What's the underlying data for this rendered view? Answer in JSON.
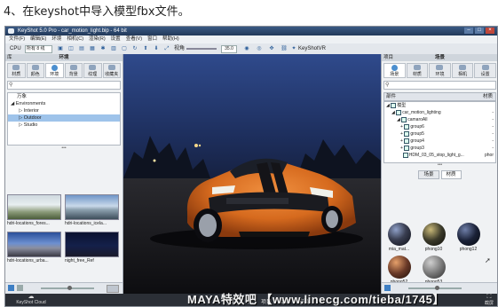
{
  "caption": "4、在keyshot中导入模型fbx文件。",
  "window": {
    "title": "KeyShot 5.0 Pro - car_motion_light.bip - 64 bit"
  },
  "menu": [
    "文件(F)",
    "编辑(E)",
    "环境",
    "相机(C)",
    "渲染(R)",
    "设置",
    "查看(V)",
    "窗口",
    "帮助(H)"
  ],
  "toolbar": {
    "cpu_label": "CPU",
    "cpu_value": "所有 8 线",
    "sight_label": "视角",
    "sight_value": "35.0",
    "vr_label": "KeyShotVR"
  },
  "library": {
    "header_left": "库",
    "title": "环境",
    "tabs": [
      "材质",
      "颜色",
      "环境",
      "背景",
      "纹理",
      "收藏夹"
    ],
    "tree": [
      "万象",
      "Environments",
      "Interior",
      "Outdoor",
      "Studio"
    ],
    "thumbs": [
      "hdri-locations_fores...",
      "hdri-locations_icela...",
      "hdri-locations_urba...",
      "night_free_Ref"
    ]
  },
  "project": {
    "header_left": "项目",
    "title": "场景",
    "tabs": [
      "场景",
      "材质",
      "环境",
      "相机",
      "设置"
    ],
    "parts_label": "部件",
    "material_col": "材质",
    "parts": [
      {
        "name": "模型",
        "mat": ""
      },
      {
        "name": "car_motion_lighting",
        "mat": "-"
      },
      {
        "name": "camaroAll",
        "mat": "-"
      },
      {
        "name": "group6",
        "mat": "-"
      },
      {
        "name": "group5",
        "mat": "-"
      },
      {
        "name": "group4",
        "mat": "-"
      },
      {
        "name": "group3",
        "mat": "-"
      },
      {
        "name": "HDM_03_05_stop_light_g...",
        "mat": "phor"
      }
    ],
    "subtabs": [
      "场景",
      "材质"
    ],
    "materials": [
      {
        "name": "mia_mat...",
        "color": "#3a3f52"
      },
      {
        "name": "phong10",
        "color": "#3b3a2a"
      },
      {
        "name": "phong12",
        "color": "#1b2238"
      },
      {
        "name": "phong52",
        "color": "#6a3a28"
      },
      {
        "name": "phong53",
        "color": "#7a7a7a"
      }
    ]
  },
  "status": {
    "cloud": "KeyShot Cloud",
    "nav": [
      "导入",
      "库",
      "项目",
      "动画",
      "渲染"
    ],
    "screenshot": "截屏"
  },
  "watermark": "MAYA特效吧 【www.linecg.com/tieba/1745】",
  "colors": {
    "car_body": "#d66a1e",
    "selection": "#9ec3ea",
    "titlebar": "#22395a"
  }
}
